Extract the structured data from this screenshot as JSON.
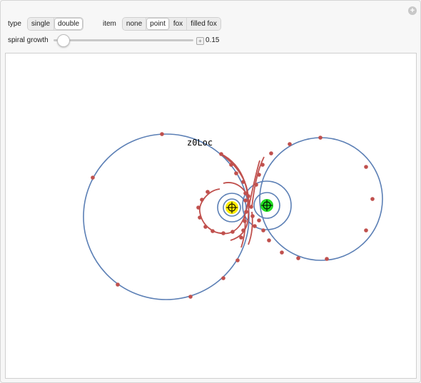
{
  "controls": {
    "type_label": "type",
    "type_options": [
      "single",
      "double"
    ],
    "type_selected": "double",
    "item_label": "item",
    "item_options": [
      "none",
      "point",
      "fox",
      "filled fox"
    ],
    "item_selected": "point",
    "slider_label": "spiral growth",
    "slider_value": "0.15",
    "slider_fraction": 0.03
  },
  "plot": {
    "annotation": "z0Loc",
    "curve_color": "#5b7fb5",
    "point_color": "#c0504d",
    "left_center_color": "#ffee00",
    "right_center_color": "#22dd22"
  }
}
